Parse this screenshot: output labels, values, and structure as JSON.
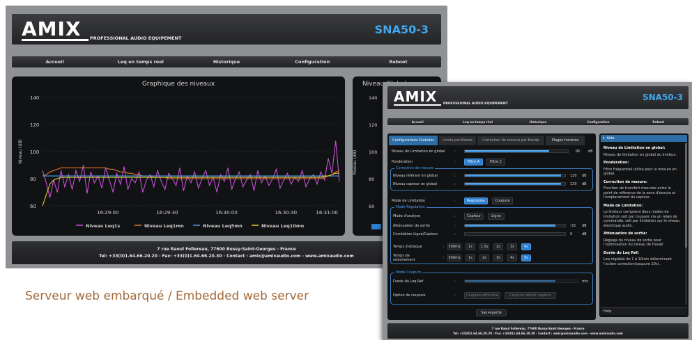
{
  "brand": {
    "logo": "AMIX",
    "tagline": "PROFESSIONAL AUDIO EQUIPEMENT",
    "model": "SNA50-3"
  },
  "nav": {
    "items": [
      "Accueil",
      "Leq en temps réel",
      "Historique",
      "Configuration",
      "Reboot"
    ]
  },
  "chart_panel": {
    "title": "Graphique des niveaux"
  },
  "side_panel": {
    "title": "Niveau Global"
  },
  "chart_data": {
    "type": "line",
    "title": "Graphique des niveaux",
    "ylabel": "Niveau (dB)",
    "xlabel": "",
    "ylim": [
      60,
      140
    ],
    "yticks": [
      60,
      80,
      100,
      120,
      140
    ],
    "xticks": [
      "16:29:00",
      "16:29:30",
      "16:30:00",
      "16:30:30",
      "16:31:00"
    ],
    "grid": true,
    "legend_position": "bottom",
    "x": [
      0,
      0.5,
      1,
      1.5,
      2,
      2.5,
      3,
      3.5,
      4,
      4.5,
      5,
      5.5,
      6,
      6.5,
      7,
      7.5,
      8,
      8.5,
      9,
      9.5,
      10,
      10.5,
      11,
      11.5,
      12,
      12.5,
      13,
      13.5,
      14,
      14.5,
      15,
      15.5,
      16,
      16.5,
      17,
      17.5,
      18,
      18.5,
      19,
      19.5,
      20,
      20.5,
      21,
      21.5,
      22,
      22.5,
      23,
      23.5,
      24,
      24.5,
      25,
      25.5,
      26,
      26.5,
      27,
      27.5,
      28,
      28.5,
      29,
      29.5,
      30,
      30.5,
      31,
      31.5,
      32,
      32.5,
      33,
      33.5,
      34,
      34.5,
      35,
      35.5,
      36,
      36.5,
      37,
      37.5,
      38,
      38.5,
      39,
      39.5,
      40
    ],
    "series": [
      {
        "name": "Niveau Leq1s",
        "color": "#c74fd6",
        "values": [
          86,
          77,
          66,
          79,
          70,
          86,
          74,
          83,
          72,
          86,
          78,
          90,
          69,
          85,
          77,
          82,
          73,
          88,
          79,
          70,
          84,
          76,
          89,
          72,
          80,
          77,
          85,
          70,
          79,
          83,
          74,
          86,
          78,
          72,
          84,
          80,
          75,
          88,
          71,
          82,
          77,
          85,
          73,
          80,
          86,
          75,
          81,
          70,
          83,
          78,
          88,
          72,
          80,
          85,
          74,
          79,
          83,
          71,
          86,
          77,
          82,
          75,
          80,
          87,
          73,
          79,
          84,
          76,
          81,
          78,
          86,
          74,
          80,
          83,
          76,
          85,
          79,
          95,
          84,
          108,
          78
        ]
      },
      {
        "name": "Niveau Leq1mn",
        "color": "#e07a2a",
        "values": [
          82,
          83,
          85,
          86,
          87,
          88,
          88,
          88,
          88,
          88,
          88,
          88,
          88,
          88,
          88,
          88,
          88,
          88,
          87,
          87,
          86,
          85,
          85,
          84,
          84,
          83,
          83,
          82,
          82,
          82,
          81,
          81,
          81,
          81,
          80,
          80,
          80,
          80,
          80,
          80,
          80,
          80,
          80,
          80,
          80,
          80,
          80,
          80,
          80,
          80,
          80,
          80,
          80,
          80,
          80,
          80,
          80,
          80,
          80,
          80,
          80,
          80,
          80,
          80,
          80,
          80,
          80,
          80,
          80,
          80,
          80,
          80,
          80,
          80,
          80,
          80,
          81,
          82,
          83,
          85,
          86
        ]
      },
      {
        "name": "Niveau Leq5mn",
        "color": "#4aa0ea",
        "values": [
          82,
          82,
          82,
          82,
          82,
          82,
          82,
          82,
          82,
          82,
          82,
          82,
          82,
          82,
          82,
          82,
          82,
          82,
          82,
          82,
          82,
          82,
          82,
          82,
          82,
          82,
          82,
          82,
          82,
          82,
          82,
          82,
          82,
          82,
          82,
          82,
          82,
          82,
          82,
          82,
          82,
          82,
          82,
          82,
          82,
          82,
          82,
          82,
          82,
          82,
          82,
          82,
          82,
          82,
          82,
          82,
          82,
          82,
          82,
          82,
          82,
          82,
          82,
          82,
          82,
          82,
          82,
          82,
          82,
          82,
          82,
          82,
          82,
          82,
          82,
          82,
          82,
          82,
          82,
          82,
          82
        ]
      },
      {
        "name": "Niveau Leq10mn",
        "color": "#e8c93a",
        "values": [
          60,
          68,
          76,
          79,
          80,
          81,
          81,
          81,
          81,
          81,
          81,
          81,
          81,
          81,
          81,
          81,
          81,
          81,
          81,
          81,
          81,
          81,
          81,
          81,
          81,
          81,
          81,
          81,
          81,
          81,
          81,
          81,
          81,
          81,
          81,
          81,
          81,
          81,
          81,
          81,
          81,
          81,
          81,
          81,
          81,
          81,
          81,
          81,
          81,
          81,
          81,
          81,
          81,
          81,
          81,
          81,
          81,
          81,
          81,
          81,
          81,
          81,
          81,
          81,
          81,
          81,
          81,
          81,
          81,
          81,
          81,
          81,
          81,
          81,
          81,
          81,
          82,
          82,
          83,
          84,
          84
        ]
      }
    ]
  },
  "side_chart": {
    "ylabel": "Niveau (dB)",
    "yticks": [
      60,
      80,
      100,
      120,
      140
    ]
  },
  "footer": {
    "address": "7 rue Raoul Follereau, 77600 Bussy-Saint-Georges - France",
    "contact": "Tel: +33(0)1.64.66.20.20 - Fax: +33(0)1.64.66.20.30 - Contact : amix@amixaudio.com - www.amixaudio.com"
  },
  "caption": "Serveur web embarqué / Embedded web server",
  "config": {
    "tabs": [
      "Configurations Globales",
      "Limite par Bande",
      "Correction de mesure par Bande",
      "Plages horaires"
    ],
    "rows": {
      "limit_global": {
        "label": "Niveau de Limitation en global",
        "value": "95",
        "unit": "dB",
        "fill": 0.82
      },
      "ponderation": {
        "label": "Pondération",
        "options": [
          "Filtre A",
          "Filtre C"
        ],
        "selected": 0
      },
      "correction_legend": "Correction de mesure",
      "ref_level": {
        "label": "Niveau référant en global",
        "value": "120",
        "unit": "dB",
        "fill": 0.96
      },
      "sensor_level": {
        "label": "Niveau capteur en global",
        "value": "120",
        "unit": "dB",
        "fill": 0.96
      },
      "mode_limit": {
        "label": "Mode de Limitation",
        "options": [
          "Régulation",
          "Coupure"
        ],
        "selected": 0
      },
      "regulation_legend": "Mode Régulation",
      "analyse": {
        "label": "Mode d'analyse",
        "options": [
          "Capteur",
          "Ligne"
        ],
        "selected": -1
      },
      "attenuation": {
        "label": "Atténuation de sortie",
        "value": "-32",
        "unit": "dB",
        "fill": 0.9
      },
      "correlation": {
        "label": "Corrélation Ligne/Capteur",
        "value": "0",
        "unit": "dB",
        "fill": 0.0
      },
      "attack": {
        "label": "Temps d'attaque",
        "options": [
          "500ms",
          "1s",
          "1.5s",
          "2s",
          "3s",
          "4s"
        ],
        "selected": 5
      },
      "release": {
        "label": "Temps de relâchement",
        "options": [
          "500ms",
          "1s",
          "2s",
          "3s",
          "4s",
          "5s"
        ],
        "selected": 5
      },
      "cut_legend": "Mode Coupure",
      "leq_ref": {
        "label": "Durée du Leq Ref",
        "unit": "min",
        "fill": 0.8
      },
      "cut_option": {
        "label": "Option de coupure",
        "options": [
          "Coupure définitive",
          "Coupure défaut capteur"
        ],
        "selected": -1
      }
    },
    "save_label": "Sauvegarde"
  },
  "aide": {
    "title": "Aide",
    "help_label": "Help",
    "sections": [
      {
        "heading": "Niveau de Limitation en global:",
        "text": "Niveau de limitation en global du limiteur."
      },
      {
        "heading": "Pondération:",
        "text": "Filtre fréquentiel utilisé pour la mesure en global."
      },
      {
        "heading": "Correction de mesure:",
        "text": "Fonction de transfert mesurée entre le point de référence de la zone d'écoute et l'emplacement du capteur."
      },
      {
        "heading": "Mode de Limitation:",
        "text": "Le limiteur comprend deux modes de limitation soit par coupure via un relais de commande, soit par limitation sur le niveau électrique audio."
      },
      {
        "heading": "Atténuation de sortie:",
        "text": "Réglage du niveau de sortie pour l'optimisation du niveau de travail"
      },
      {
        "heading": "Durée du Leq Ref:",
        "text": "Leq réglable de 1 à 10min déterminant l'action corrective(coupure 10s)."
      }
    ]
  }
}
